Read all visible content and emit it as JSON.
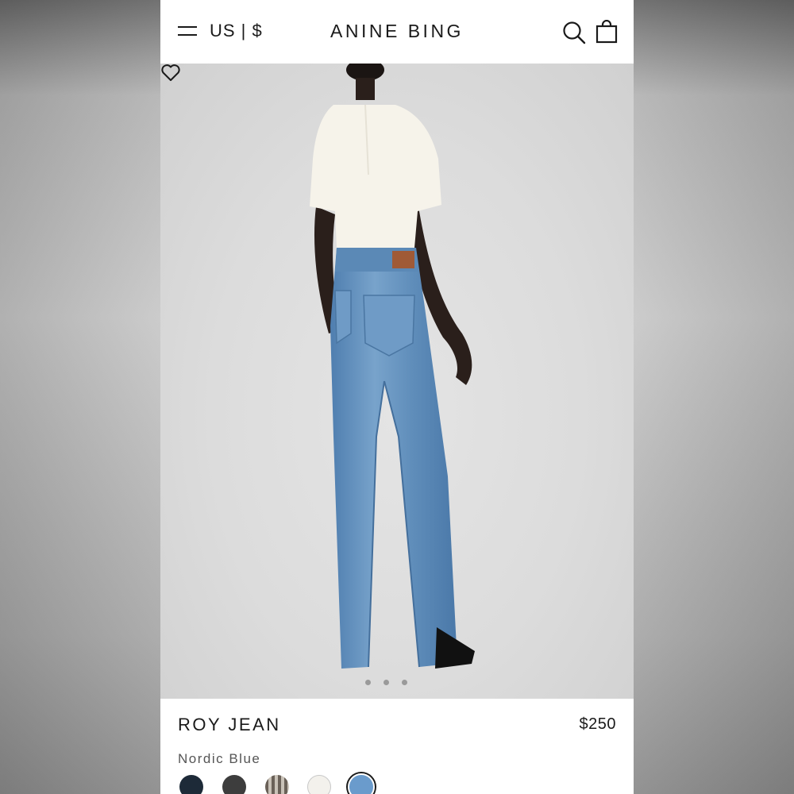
{
  "header": {
    "menu_icon": "hamburger-menu-icon",
    "locale": "US | $",
    "brand": "ANINE BING",
    "search_icon": "search-icon",
    "bag_icon": "shopping-bag-icon"
  },
  "gallery": {
    "image_alt": "model wearing light blue straight jeans and white top, rear view",
    "slide_count": 3,
    "favorite_icon": "heart-icon"
  },
  "product": {
    "name": "ROY JEAN",
    "price": "$250",
    "color_name": "Nordic Blue",
    "swatches": [
      {
        "name": "dark-navy",
        "color": "#1d2a38"
      },
      {
        "name": "charcoal",
        "color": "#3d3d3d"
      },
      {
        "name": "striped",
        "color": "#8a8178"
      },
      {
        "name": "ecru",
        "color": "#f3f1ec"
      },
      {
        "name": "nordic-blue",
        "color": "#6a9bcc",
        "selected": true
      }
    ]
  }
}
